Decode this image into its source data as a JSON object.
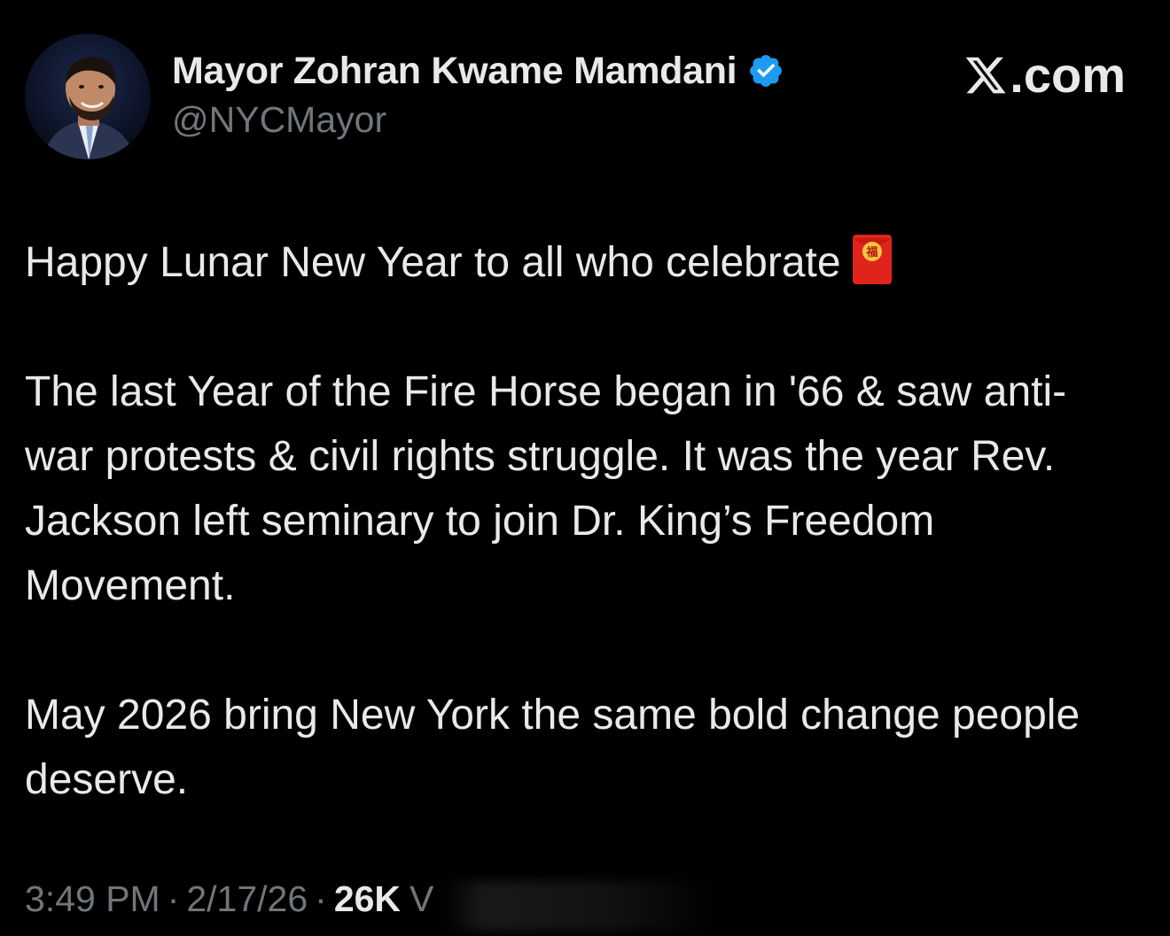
{
  "author": {
    "display_name": "Mayor Zohran Kwame Mamdani",
    "handle": "@NYCMayor",
    "verified": true,
    "verified_color": "#1d9bf0"
  },
  "brand": {
    "label": ".com",
    "icon": "x-logo-icon"
  },
  "post": {
    "paragraph_1": "Happy Lunar New Year to all who celebrate",
    "paragraph_1_emoji": "red-envelope-icon",
    "paragraph_2": "The last Year of the Fire Horse began in '66 & saw anti-war protests & civil rights struggle. It was the year Rev. Jackson left seminary to join Dr. King’s Freedom Movement.",
    "paragraph_3": "May 2026 bring New York the same bold change people deserve."
  },
  "meta": {
    "time": "3:49 PM",
    "separator": "·",
    "date": "2/17/26",
    "views_count": "26K",
    "views_label": "V"
  },
  "colors": {
    "background": "#000000",
    "text_primary": "#e7e9ea",
    "text_secondary": "#71767b",
    "accent_blue": "#1d9bf0",
    "envelope_red": "#e0241b"
  }
}
